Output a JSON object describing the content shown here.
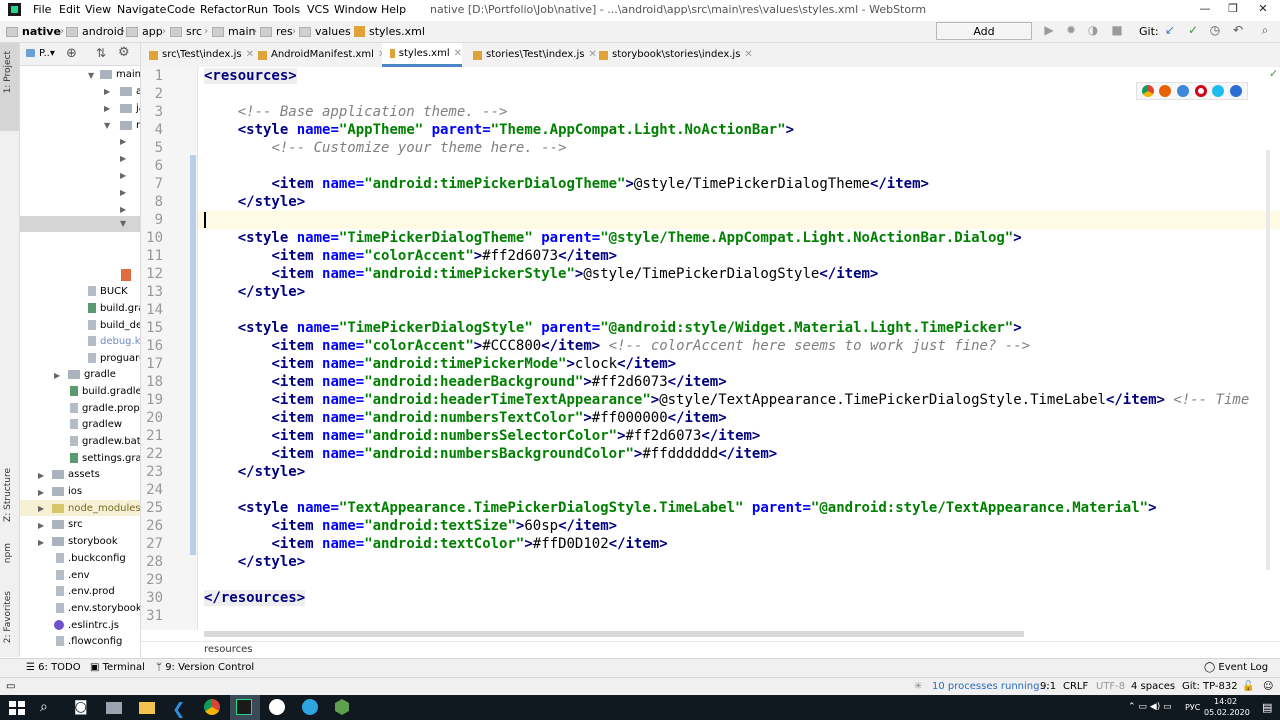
{
  "menu": {
    "items": [
      "File",
      "Edit",
      "View",
      "Navigate",
      "Code",
      "Refactor",
      "Run",
      "Tools",
      "VCS",
      "Window",
      "Help"
    ],
    "window_title": "native [D:\\Portfolio\\Job\\native] - ...\\android\\app\\src\\main\\res\\values\\styles.xml - WebStorm"
  },
  "nav": {
    "crumbs": [
      "native",
      "android",
      "app",
      "src",
      "main",
      "res",
      "values",
      "styles.xml"
    ],
    "run_config": "Add Configuration...",
    "git_label": "Git:"
  },
  "project": {
    "header": "P..▾",
    "items": [
      {
        "label": "main"
      },
      {
        "label": "a"
      },
      {
        "label": "ja"
      },
      {
        "label": "r"
      },
      {
        "label": "BUCK"
      },
      {
        "label": "build.gra"
      },
      {
        "label": "build_de"
      },
      {
        "label": "debug.ke"
      },
      {
        "label": "proguarc"
      },
      {
        "label": "gradle"
      },
      {
        "label": "build.gradle"
      },
      {
        "label": "gradle.prope"
      },
      {
        "label": "gradlew"
      },
      {
        "label": "gradlew.bat"
      },
      {
        "label": "settings.grac"
      },
      {
        "label": "assets"
      },
      {
        "label": "ios"
      },
      {
        "label": "node_modules"
      },
      {
        "label": "src"
      },
      {
        "label": "storybook"
      },
      {
        "label": ".buckconfig"
      },
      {
        "label": ".env"
      },
      {
        "label": ".env.prod"
      },
      {
        "label": ".env.storybook"
      },
      {
        "label": ".eslintrc.js"
      },
      {
        "label": ".flowconfig"
      }
    ]
  },
  "side_labels": {
    "project": "1: Project",
    "structure": "Z: Structure",
    "npm": "npm",
    "favorites": "2: Favorites"
  },
  "tabs": [
    {
      "label": "src\\Test\\index.js"
    },
    {
      "label": "AndroidManifest.xml"
    },
    {
      "label": "styles.xml"
    },
    {
      "label": "stories\\Test\\index.js"
    },
    {
      "label": "storybook\\stories\\index.js"
    }
  ],
  "editor": {
    "line_numbers": [
      "1",
      "2",
      "3",
      "4",
      "5",
      "6",
      "7",
      "8",
      "9",
      "10",
      "11",
      "12",
      "13",
      "14",
      "15",
      "16",
      "17",
      "18",
      "19",
      "20",
      "21",
      "22",
      "23",
      "24",
      "25",
      "26",
      "27",
      "28",
      "29",
      "30",
      "31"
    ],
    "breadcrumb": "resources",
    "code": {
      "l3": "<!-- Base application theme. -->",
      "l4_name": "\"AppTheme\"",
      "l4_parent": "\"Theme.AppCompat.Light.NoActionBar\"",
      "l5": "<!-- Customize your theme here. -->",
      "l7_name": "\"android:timePickerDialogTheme\"",
      "l7_val": "@style/TimePickerDialogTheme",
      "l10_name": "\"TimePickerDialogTheme\"",
      "l10_parent": "\"@style/Theme.AppCompat.Light.NoActionBar.Dialog\"",
      "l11_name": "\"colorAccent\"",
      "l11_val": "#ff2d6073",
      "l12_name": "\"android:timePickerStyle\"",
      "l12_val": "@style/TimePickerDialogStyle",
      "l15_name": "\"TimePickerDialogStyle\"",
      "l15_parent": "\"@android:style/Widget.Material.Light.TimePicker\"",
      "l16_name": "\"colorAccent\"",
      "l16_val": "#CCC800",
      "l16_cm": "<!-- colorAccent here seems to work just fine? -->",
      "l17_name": "\"android:timePickerMode\"",
      "l17_val": "clock",
      "l18_name": "\"android:headerBackground\"",
      "l18_val": "#ff2d6073",
      "l19_name": "\"android:headerTimeTextAppearance\"",
      "l19_val": "@style/TextAppearance.TimePickerDialogStyle.TimeLabel",
      "l19_cm": "<!-- Time",
      "l20_name": "\"android:numbersTextColor\"",
      "l20_val": "#ff000000",
      "l21_name": "\"android:numbersSelectorColor\"",
      "l21_val": "#ff2d6073",
      "l22_name": "\"android:numbersBackgroundColor\"",
      "l22_val": "#ffdddddd",
      "l25_name": "\"TextAppearance.TimePickerDialogStyle.TimeLabel\"",
      "l25_parent": "\"@android:style/TextAppearance.Material\"",
      "l26_name": "\"android:textSize\"",
      "l26_val": "60sp",
      "l27_name": "\"android:textColor\"",
      "l27_val": "#ffD0D102",
      "t_resources_open": "<resources>",
      "t_resources_close": "</resources>",
      "t_style_open": "<style",
      "t_style_close": "</style>",
      "t_item_open": "<item",
      "t_item_close": "</item>",
      "a_name": "name=",
      "a_parent": "parent=",
      "gt": ">"
    }
  },
  "toolwindows": {
    "todo": "6: TODO",
    "terminal": "Terminal",
    "vcs": "9: Version Control",
    "eventlog": "Event Log"
  },
  "status": {
    "processes": "10 processes running...",
    "position": "9:1",
    "line_sep": "CRLF",
    "encoding": "UTF-8",
    "indent": "4 spaces",
    "git_branch": "Git: TP-832"
  },
  "taskbar": {
    "lang": "РУС",
    "time": "14:02",
    "date": "05.02.2020"
  },
  "colors": {
    "tag": "#000080",
    "attr": "#0000ff",
    "value": "#008000",
    "comment": "#808080"
  }
}
